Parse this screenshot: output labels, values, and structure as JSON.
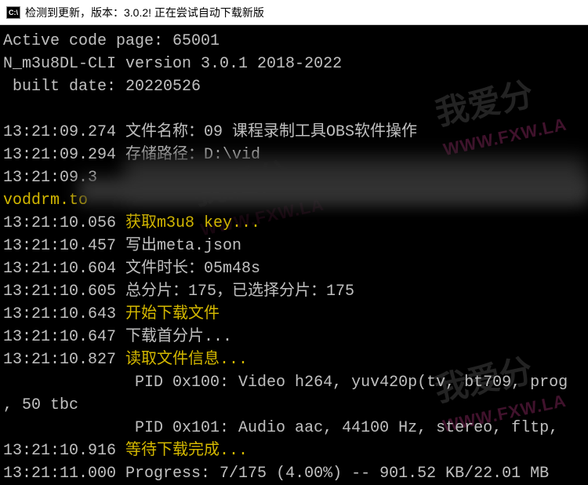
{
  "titlebar": {
    "icon_label": "C:\\",
    "title": "检测到更新，版本：3.0.2! 正在尝试自动下载新版"
  },
  "terminal": {
    "header": [
      "Active code page: 65001",
      "N_m3u8DL-CLI version 3.0.1 2018-2022",
      " built date: 20220526",
      ""
    ],
    "log": [
      {
        "ts": "13:21:09.274",
        "label": "文件名称：",
        "text": "09 课程录制工具OBS软件操作",
        "color": "plain"
      },
      {
        "ts": "13:21:09.294",
        "label": "存储路径：",
        "text": "D:\\vid",
        "color": "plain"
      },
      {
        "ts": "13:21:09.3",
        "label": "",
        "text": "",
        "color": "plain"
      },
      {
        "ts": "",
        "label": "",
        "text": "voddrm.to",
        "color": "yellow"
      },
      {
        "ts": "13:21:10.056",
        "label": "",
        "text": "获取m3u8 key...",
        "color": "yellow"
      },
      {
        "ts": "13:21:10.457",
        "label": "",
        "text": "写出meta.json",
        "color": "plain"
      },
      {
        "ts": "13:21:10.604",
        "label": "文件时长：",
        "text": "05m48s",
        "color": "plain"
      },
      {
        "ts": "13:21:10.605",
        "label": "总分片：",
        "text": "175，已选择分片：175",
        "color": "plain"
      },
      {
        "ts": "13:21:10.643",
        "label": "",
        "text": "开始下载文件",
        "color": "yellow"
      },
      {
        "ts": "13:21:10.647",
        "label": "",
        "text": "下载首分片...",
        "color": "plain"
      },
      {
        "ts": "13:21:10.827",
        "label": "",
        "text": "读取文件信息...",
        "color": "yellow"
      },
      {
        "ts": "",
        "label": "",
        "text": "              PID 0x100: Video h264, yuv420p(tv, bt709, prog",
        "color": "plain"
      },
      {
        "ts": "",
        "label": "",
        "text": ", 50 tbc",
        "color": "plain"
      },
      {
        "ts": "",
        "label": "",
        "text": "              PID 0x101: Audio aac, 44100 Hz, stereo, fltp,",
        "color": "plain"
      },
      {
        "ts": "13:21:10.916",
        "label": "",
        "text": "等待下载完成...",
        "color": "yellow"
      },
      {
        "ts": "13:21:11.000",
        "label": "Progress: ",
        "text": "7/175 (4.00%) -- 901.52 KB/22.01 MB",
        "color": "plain"
      }
    ]
  },
  "watermark": {
    "text": "我爱分",
    "url": "WWW.FXW.LA"
  }
}
